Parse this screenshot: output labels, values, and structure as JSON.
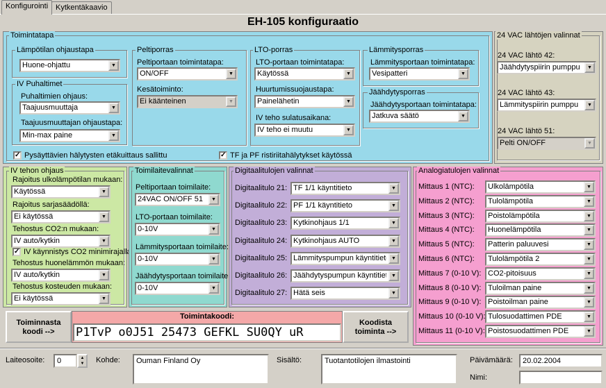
{
  "tabs": [
    "Konfigurointi",
    "Kytkentäkaavio"
  ],
  "title": "EH-105 konfiguraatio",
  "colors": {
    "cyan": "#99d9ea",
    "khaki": "#d6d3c0",
    "green": "#cce8a4",
    "teal": "#8fd9cf",
    "purple": "#c2aed8",
    "pink": "#f59fcf",
    "code": "#f4a8a8"
  },
  "toimintatapa": {
    "legend": "Toimintatapa",
    "lampotila": {
      "legend": "Lämpötilan ohjaustapa",
      "value": "Huone-ohjattu"
    },
    "iv": {
      "legend": "IV Puhaltimet",
      "ohjaus_label": "Puhaltimien ohjaus:",
      "ohjaus_value": "Taajuusmuuttaja",
      "taaj_label": "Taajuusmuuttajan ohjaustapa:",
      "taaj_value": "Min-max paine"
    },
    "pelti": {
      "legend": "Peltiporras",
      "toim_label": "Peltiportaan toimintatapa:",
      "toim_value": "ON/OFF",
      "kesa_label": "Kesätoiminto:",
      "kesa_value": "Ei käänteinen"
    },
    "lto": {
      "legend": "LTO-porras",
      "toim_label": "LTO-portaan toimintatapa:",
      "toim_value": "Käytössä",
      "huur_label": "Huurtumissuojaustapa:",
      "huur_value": "Painelähetin",
      "teho_label": "IV teho sulatusaikana:",
      "teho_value": "IV teho ei muutu"
    },
    "lamm": {
      "legend": "Lämmitysporras",
      "toim_label": "Lämmitysportaan toimintatapa:",
      "toim_value": "Vesipatteri"
    },
    "jaah": {
      "legend": "Jäähdytysporras",
      "toim_label": "Jäähdytysportaan toimintatapa:",
      "toim_value": "Jatkuva säätö"
    },
    "chk1": "Pysäyttävien hälytysten etäkuittaus sallittu",
    "chk2": "TF ja PF ristiriitahälytykset käytössä"
  },
  "vac": {
    "legend": "24 VAC lähtöjen valinnat",
    "l42_label": "24 VAC lähtö 42:",
    "l42_value": "Jäähdytyspiirin pumppu",
    "l43_label": "24 VAC lähtö 43:",
    "l43_value": "Lämmityspiirin pumppu",
    "l51_label": "24 VAC lähtö 51:",
    "l51_value": "Pelti ON/OFF"
  },
  "ivteho": {
    "legend": "IV tehon ohjaus",
    "r1_label": "Rajoitus ulkolämpötilan mukaan:",
    "r1_value": "Käytössä",
    "r2_label": "Rajoitus sarjasäädöllä:",
    "r2_value": "Ei käytössä",
    "t1_label": "Tehostus CO2:n mukaan:",
    "t1_value": "IV auto/kytkin",
    "chk": "IV käynnistys CO2 minimirajalla",
    "t2_label": "Tehostus huonelämmön mukaan:",
    "t2_value": "IV auto/kytkin",
    "t3_label": "Tehostus kosteuden mukaan:",
    "t3_value": "Ei käytössä"
  },
  "toimilaite": {
    "legend": "Toimilaitevalinnat",
    "p_label": "Peltiportaan toimilaite:",
    "p_value": "24VAC ON/OFF 51",
    "l_label": "LTO-portaan toimilaite:",
    "l_value": "0-10V",
    "m_label": "Lämmitysportaan toimilaite:",
    "m_value": "0-10V",
    "j_label": "Jäähdytysportaan toimilaite:",
    "j_value": "0-10V"
  },
  "digital": {
    "legend": "Digitaalitulojen valinnat",
    "items": [
      {
        "label": "Digitaalitulo 21:",
        "value": "TF 1/1 käyntitieto"
      },
      {
        "label": "Digitaalitulo 22:",
        "value": "PF 1/1 käyntitieto"
      },
      {
        "label": "Digitaalitulo 23:",
        "value": "Kytkinohjaus 1/1"
      },
      {
        "label": "Digitaalitulo 24:",
        "value": "Kytkinohjaus AUTO"
      },
      {
        "label": "Digitaalitulo 25:",
        "value": "Lämmityspumpun käyntitieto"
      },
      {
        "label": "Digitaalitulo 26:",
        "value": "Jäähdytyspumpun käyntitieto"
      },
      {
        "label": "Digitaalitulo 27:",
        "value": "Hätä seis"
      }
    ]
  },
  "analog": {
    "legend": "Analogiatulojen valinnat",
    "items": [
      {
        "label": "Mittaus 1 (NTC):",
        "value": "Ulkolämpötila"
      },
      {
        "label": "Mittaus 2 (NTC):",
        "value": "Tulolämpötila"
      },
      {
        "label": "Mittaus 3 (NTC):",
        "value": "Poistolämpötila"
      },
      {
        "label": "Mittaus 4 (NTC):",
        "value": "Huonelämpötila"
      },
      {
        "label": "Mittaus 5 (NTC):",
        "value": "Patterin paluuvesi"
      },
      {
        "label": "Mittaus 6 (NTC):",
        "value": "Tulolämpötila 2"
      },
      {
        "label": "Mittaus 7 (0-10 V):",
        "value": "CO2-pitoisuus"
      },
      {
        "label": "Mittaus 8 (0-10 V):",
        "value": "Tuloilman paine"
      },
      {
        "label": "Mittaus 9 (0-10 V):",
        "value": "Poistoilman paine"
      },
      {
        "label": "Mittaus 10 (0-10 V):",
        "value": "Tulosuodattimen PDE"
      },
      {
        "label": "Mittaus 11 (0-10 V):",
        "value": "Poistosuodattimen PDE"
      }
    ]
  },
  "code": {
    "btn_left": "Toiminnasta koodi -->",
    "btn_right": "Koodista toiminta -->",
    "label": "Toimintakoodi:",
    "value": "P1TvP o0J51 25473 GEFKL SU0QY uR"
  },
  "footer": {
    "laite_label": "Laiteosoite:",
    "laite_value": "0",
    "kohde_label": "Kohde:",
    "kohde_value": "Ouman Finland Oy",
    "sisalto_label": "Sisältö:",
    "sisalto_value": "Tuotantotilojen ilmastointi",
    "pvm_label": "Päivämäärä:",
    "pvm_value": "20.02.2004",
    "nimi_label": "Nimi:",
    "nimi_value": ""
  }
}
